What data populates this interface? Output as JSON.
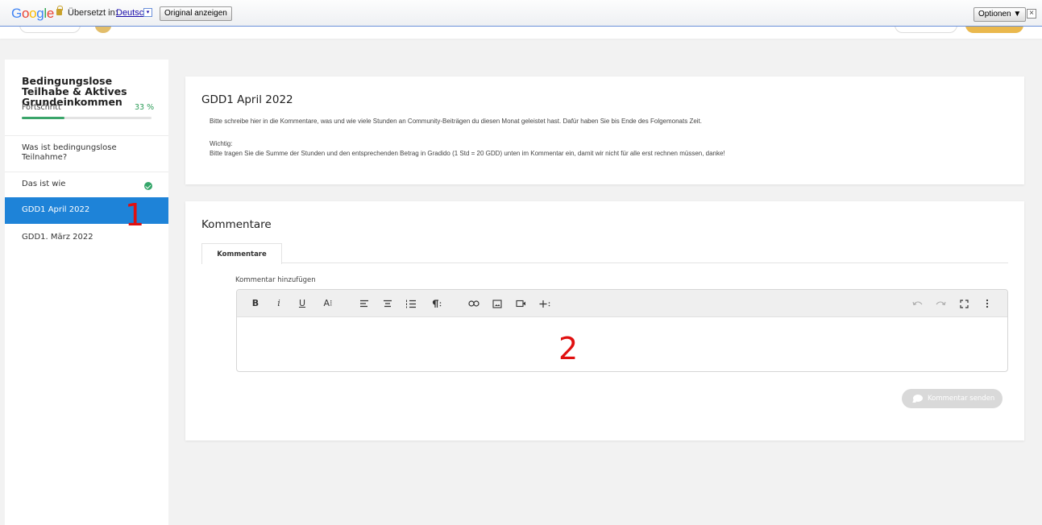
{
  "translate_bar": {
    "logo": "Google",
    "translated_label": "Übersetzt in:",
    "language": "Deutsch",
    "language_dropdown": "▾",
    "original_button": "Original anzeigen",
    "options_button": "Optionen ▼",
    "close": "×",
    "colors": {
      "g_blue": "#4285f4",
      "g_red": "#ea4335",
      "g_yellow": "#fbbc05",
      "g_green": "#34a853"
    }
  },
  "sidebar": {
    "course_title": "Bedingungslose Teilhabe & Aktives Grundeinkommen",
    "progress_label": "Fortschritt",
    "progress_value": "33 %",
    "progress_fraction": 0.33,
    "lessons": [
      {
        "label": "Was ist bedingungslose Teilnahme?"
      },
      {
        "label": "Das ist wie",
        "completed": true
      },
      {
        "label": "GDD1 April 2022",
        "active": true
      },
      {
        "label": "GDD1. März 2022"
      }
    ],
    "accent_color": "#1e83d8"
  },
  "annotations": {
    "one": "1",
    "two": "2"
  },
  "lesson_card": {
    "title": "GDD1 April 2022",
    "paragraph_1": "Bitte schreibe hier in die Kommentare, was und wie viele Stunden an Community-Beiträgen du diesen Monat geleistet hast. Dafür haben Sie bis Ende des Folgemonats Zeit.",
    "paragraph_2": "Wichtig:",
    "paragraph_3": "Bitte tragen Sie die Summe der Stunden und den entsprechenden Betrag in Gradido (1 Std = 20 GDD) unten im Kommentar ein, damit wir nicht für alle erst rechnen müssen, danke!"
  },
  "comments": {
    "title": "Kommentare",
    "tab_label": "Kommentare",
    "add_label": "Kommentar hinzufügen",
    "toolbar": {
      "bold": "B",
      "italic": "i",
      "underline": "U",
      "font_size": "A⁝",
      "icons": [
        "align-left-icon",
        "align-center-icon",
        "ordered-list-icon",
        "paragraph-icon",
        "link-icon",
        "image-icon",
        "video-icon",
        "plus-icon",
        "undo-icon",
        "redo-icon",
        "fullscreen-icon",
        "more-vertical-icon"
      ]
    },
    "send_button": "Kommentar senden"
  }
}
